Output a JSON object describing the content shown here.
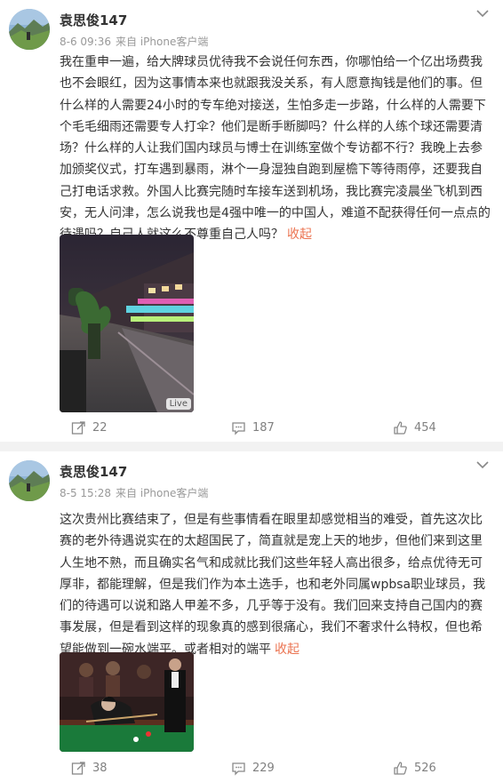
{
  "posts": [
    {
      "author": "袁思俊147",
      "time": "8-6 09:36",
      "source": "来自 iPhone客户端",
      "text": "我在重申一遍，给大牌球员优待我不会说任何东西，你哪怕给一个亿出场费我也不会眼红，因为这事情本来也就跟我没关系，有人愿意掏钱是他们的事。但什么样的人需要24小时的专车绝对接送，生怕多走一步路，什么样的人需要下个毛毛细雨还需要专人打伞？他们是断手断脚吗？什么样的人练个球还需要清场？什么样的人让我们国内球员与博士在训练室做个专访都不行？我晚上去参加颁奖仪式，打车遇到暴雨，淋个一身湿独自跑到屋檐下等待雨停，还要我自己打电话求救。外国人比赛完随时车接车送到机场，我比赛完凌晨坐飞机到西安，无人问津，怎么说我也是4强中唯一的中国人，难道不配获得任何一点点的待遇吗？自己人就这么不尊重自己人吗？",
      "collapse": "收起",
      "image_badge": "Live",
      "image_icon": "live-photo-rainy-street-image",
      "reposts": "22",
      "comments": "187",
      "likes": "454"
    },
    {
      "author": "袁思俊147",
      "time": "8-5 15:28",
      "source": "来自 iPhone客户端",
      "text": "这次贵州比赛结束了，但是有些事情看在眼里却感觉相当的难受，首先这次比赛的老外待遇说实在的太超国民了，简直就是宠上天的地步，但他们来到这里人生地不熟，而且确实名气和成就比我们这些年轻人高出很多，给点优待无可厚非，都能理解，但是我们作为本土选手，也和老外同属wpbsa职业球员，我们的待遇可以说和路人甲差不多，几乎等于没有。我们回来支持自己国内的赛事发展，但是看到这样的现象真的感到很痛心，我们不奢求什么特权，但也希望能做到一碗水端平。或者相对的端平",
      "collapse": "收起",
      "image_icon": "snooker-player-photo-image",
      "reposts": "38",
      "comments": "229",
      "likes": "526"
    }
  ],
  "colors": {
    "accent": "#eb7350",
    "meta": "#999999",
    "action": "#808080"
  }
}
